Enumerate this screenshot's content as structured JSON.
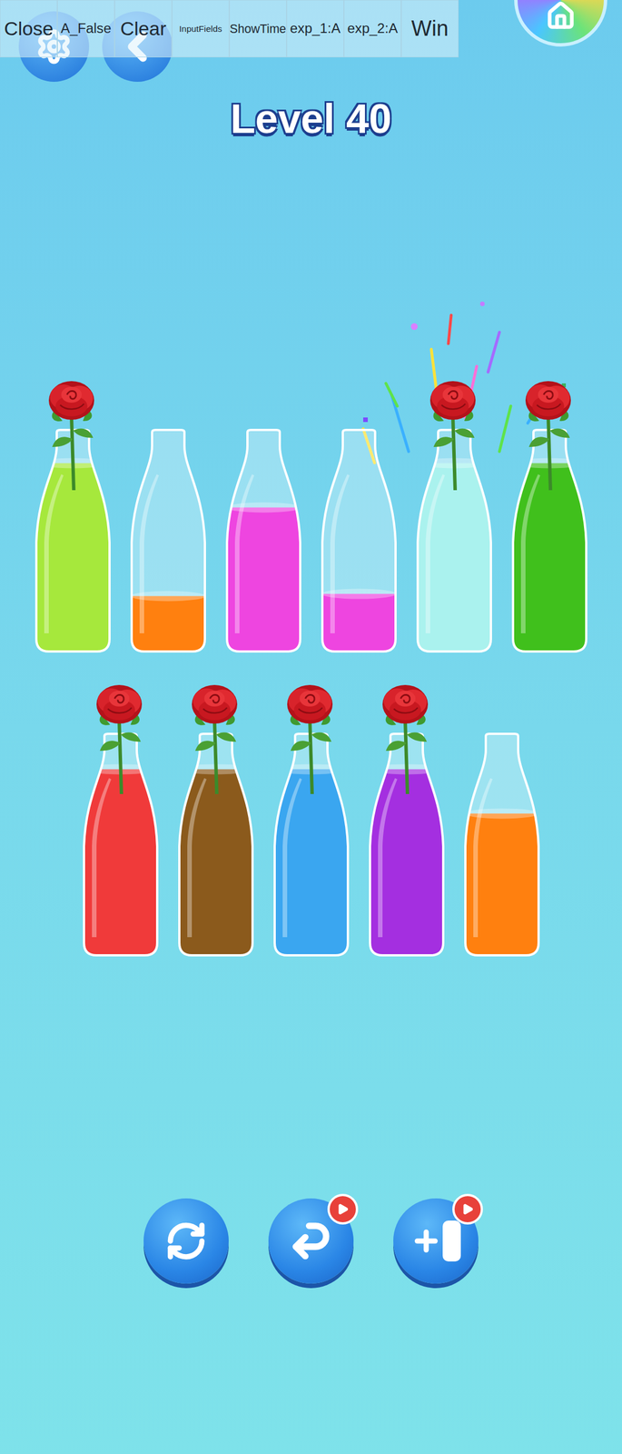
{
  "debug_bar": {
    "buttons": [
      "Close",
      "A_False",
      "Clear",
      "InputFields",
      "ShowTime",
      "exp_1:A",
      "exp_2:A",
      "Win"
    ]
  },
  "title": "Level 40",
  "rows": [
    [
      {
        "color": "#a6e83c",
        "level": 0.85,
        "completed": true
      },
      {
        "color": "#ff800f",
        "level": 0.25,
        "completed": false
      },
      {
        "color": "#ee45e0",
        "level": 0.65,
        "completed": false
      },
      {
        "color": "#ee45e0",
        "level": 0.26,
        "completed": false
      },
      {
        "color": "#aaf2ee",
        "level": 0.85,
        "completed": true
      },
      {
        "color": "#40c01c",
        "level": 0.85,
        "completed": true
      }
    ],
    [
      {
        "color": "#f03a3a",
        "level": 0.84,
        "completed": true
      },
      {
        "color": "#8b5a1c",
        "level": 0.84,
        "completed": true
      },
      {
        "color": "#3aa6f0",
        "level": 0.84,
        "completed": true
      },
      {
        "color": "#a42fe0",
        "level": 0.84,
        "completed": true
      },
      {
        "color": "#ff800f",
        "level": 0.64,
        "completed": false
      }
    ]
  ],
  "controls": [
    {
      "kind": "restart",
      "ad": false
    },
    {
      "kind": "undo",
      "ad": true
    },
    {
      "kind": "add",
      "ad": true
    }
  ]
}
